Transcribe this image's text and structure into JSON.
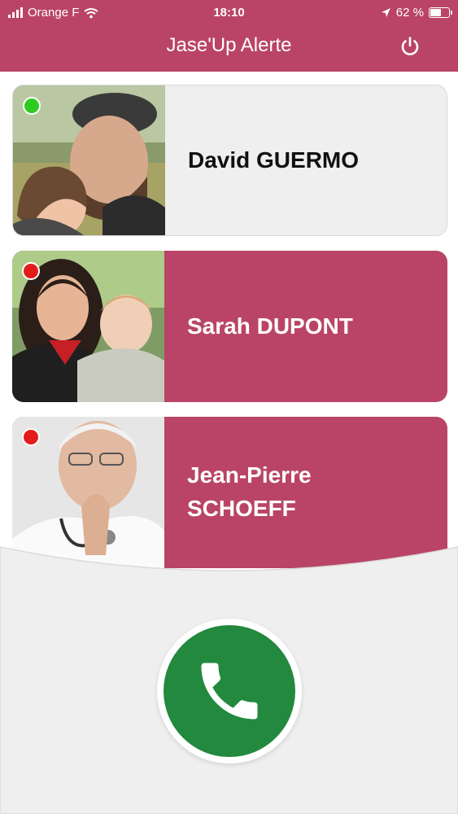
{
  "status_bar": {
    "carrier": "Orange F",
    "time": "18:10",
    "battery_percent": "62 %",
    "battery_level": 0.62
  },
  "header": {
    "title": "Jase'Up Alerte",
    "power_icon": "power-icon"
  },
  "contacts": [
    {
      "name_line1": "David GUERMO",
      "name_line2": "",
      "online": true,
      "dot_color": "#2ecc1f"
    },
    {
      "name_line1": "Sarah DUPONT",
      "name_line2": "",
      "online": false,
      "dot_color": "#e31b1b"
    },
    {
      "name_line1": "Jean-Pierre",
      "name_line2": "SCHOEFF",
      "online": false,
      "dot_color": "#e31b1b"
    }
  ],
  "call_button": {
    "icon": "phone-icon",
    "color": "#23893e"
  },
  "colors": {
    "brand": "#b94467",
    "online": "#2ecc1f",
    "offline": "#e31b1b",
    "call": "#23893e"
  }
}
